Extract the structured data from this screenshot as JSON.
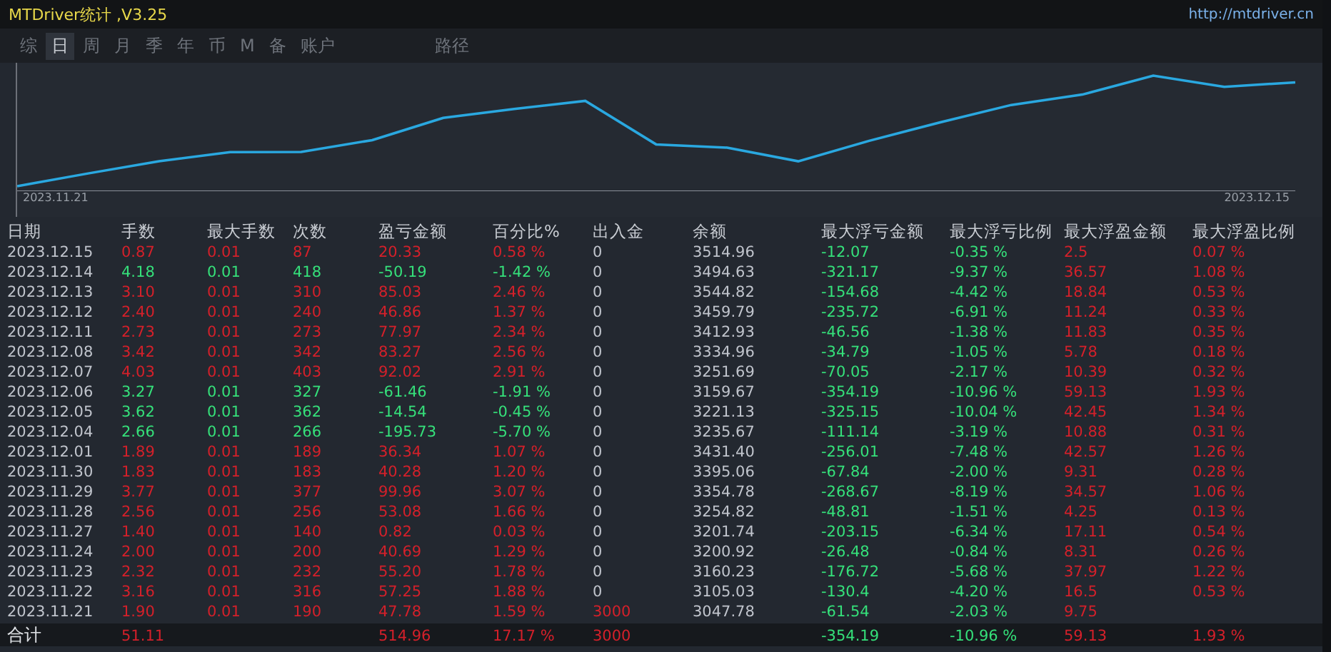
{
  "window": {
    "title": "MTDriver统计 ,V3.25",
    "link": "http://mtdriver.cn"
  },
  "tabs": [
    {
      "label": "综",
      "selected": false
    },
    {
      "label": "日",
      "selected": true
    },
    {
      "label": "周",
      "selected": false
    },
    {
      "label": "月",
      "selected": false
    },
    {
      "label": "季",
      "selected": false
    },
    {
      "label": "年",
      "selected": false
    },
    {
      "label": "币",
      "selected": false
    },
    {
      "label": "M",
      "selected": false
    },
    {
      "label": "备",
      "selected": false
    },
    {
      "label": "账户",
      "selected": false
    },
    {
      "label": "路径",
      "selected": false
    }
  ],
  "chart": {
    "start_label": "2023.11.21",
    "end_label": "2023.12.15"
  },
  "table": {
    "columns": [
      {
        "label": "日期",
        "kind": "plain"
      },
      {
        "label": "手数",
        "kind": "result"
      },
      {
        "label": "最大手数",
        "kind": "result"
      },
      {
        "label": "次数",
        "kind": "result"
      },
      {
        "label": "盈亏金额",
        "kind": "result"
      },
      {
        "label": "百分比%",
        "kind": "result"
      },
      {
        "label": "出入金",
        "kind": "deposit"
      },
      {
        "label": "余额",
        "kind": "plain"
      },
      {
        "label": "最大浮亏金额",
        "kind": "loss"
      },
      {
        "label": "最大浮亏比例",
        "kind": "loss"
      },
      {
        "label": "最大浮盈金额",
        "kind": "gain"
      },
      {
        "label": "最大浮盈比例",
        "kind": "gain"
      }
    ],
    "rows": [
      {
        "loss": false,
        "deposit": false,
        "cells": [
          "2023.12.15",
          "0.87",
          "0.01",
          "87",
          "20.33",
          "0.58 %",
          "0",
          "3514.96",
          "-12.07",
          "-0.35 %",
          "2.5",
          "0.07 %"
        ]
      },
      {
        "loss": true,
        "deposit": false,
        "cells": [
          "2023.12.14",
          "4.18",
          "0.01",
          "418",
          "-50.19",
          "-1.42 %",
          "0",
          "3494.63",
          "-321.17",
          "-9.37 %",
          "36.57",
          "1.08 %"
        ]
      },
      {
        "loss": false,
        "deposit": false,
        "cells": [
          "2023.12.13",
          "3.10",
          "0.01",
          "310",
          "85.03",
          "2.46 %",
          "0",
          "3544.82",
          "-154.68",
          "-4.42 %",
          "18.84",
          "0.53 %"
        ]
      },
      {
        "loss": false,
        "deposit": false,
        "cells": [
          "2023.12.12",
          "2.40",
          "0.01",
          "240",
          "46.86",
          "1.37 %",
          "0",
          "3459.79",
          "-235.72",
          "-6.91 %",
          "11.24",
          "0.33 %"
        ]
      },
      {
        "loss": false,
        "deposit": false,
        "cells": [
          "2023.12.11",
          "2.73",
          "0.01",
          "273",
          "77.97",
          "2.34 %",
          "0",
          "3412.93",
          "-46.56",
          "-1.38 %",
          "11.83",
          "0.35 %"
        ]
      },
      {
        "loss": false,
        "deposit": false,
        "cells": [
          "2023.12.08",
          "3.42",
          "0.01",
          "342",
          "83.27",
          "2.56 %",
          "0",
          "3334.96",
          "-34.79",
          "-1.05 %",
          "5.78",
          "0.18 %"
        ]
      },
      {
        "loss": false,
        "deposit": false,
        "cells": [
          "2023.12.07",
          "4.03",
          "0.01",
          "403",
          "92.02",
          "2.91 %",
          "0",
          "3251.69",
          "-70.05",
          "-2.17 %",
          "10.39",
          "0.32 %"
        ]
      },
      {
        "loss": true,
        "deposit": false,
        "cells": [
          "2023.12.06",
          "3.27",
          "0.01",
          "327",
          "-61.46",
          "-1.91 %",
          "0",
          "3159.67",
          "-354.19",
          "-10.96 %",
          "59.13",
          "1.93 %"
        ]
      },
      {
        "loss": true,
        "deposit": false,
        "cells": [
          "2023.12.05",
          "3.62",
          "0.01",
          "362",
          "-14.54",
          "-0.45 %",
          "0",
          "3221.13",
          "-325.15",
          "-10.04 %",
          "42.45",
          "1.34 %"
        ]
      },
      {
        "loss": true,
        "deposit": false,
        "cells": [
          "2023.12.04",
          "2.66",
          "0.01",
          "266",
          "-195.73",
          "-5.70 %",
          "0",
          "3235.67",
          "-111.14",
          "-3.19 %",
          "10.88",
          "0.31 %"
        ]
      },
      {
        "loss": false,
        "deposit": false,
        "cells": [
          "2023.12.01",
          "1.89",
          "0.01",
          "189",
          "36.34",
          "1.07 %",
          "0",
          "3431.40",
          "-256.01",
          "-7.48 %",
          "42.57",
          "1.26 %"
        ]
      },
      {
        "loss": false,
        "deposit": false,
        "cells": [
          "2023.11.30",
          "1.83",
          "0.01",
          "183",
          "40.28",
          "1.20 %",
          "0",
          "3395.06",
          "-67.84",
          "-2.00 %",
          "9.31",
          "0.28 %"
        ]
      },
      {
        "loss": false,
        "deposit": false,
        "cells": [
          "2023.11.29",
          "3.77",
          "0.01",
          "377",
          "99.96",
          "3.07 %",
          "0",
          "3354.78",
          "-268.67",
          "-8.19 %",
          "34.57",
          "1.06 %"
        ]
      },
      {
        "loss": false,
        "deposit": false,
        "cells": [
          "2023.11.28",
          "2.56",
          "0.01",
          "256",
          "53.08",
          "1.66 %",
          "0",
          "3254.82",
          "-48.81",
          "-1.51 %",
          "4.25",
          "0.13 %"
        ]
      },
      {
        "loss": false,
        "deposit": false,
        "cells": [
          "2023.11.27",
          "1.40",
          "0.01",
          "140",
          "0.82",
          "0.03 %",
          "0",
          "3201.74",
          "-203.15",
          "-6.34 %",
          "17.11",
          "0.54 %"
        ]
      },
      {
        "loss": false,
        "deposit": false,
        "cells": [
          "2023.11.24",
          "2.00",
          "0.01",
          "200",
          "40.69",
          "1.29 %",
          "0",
          "3200.92",
          "-26.48",
          "-0.84 %",
          "8.31",
          "0.26 %"
        ]
      },
      {
        "loss": false,
        "deposit": false,
        "cells": [
          "2023.11.23",
          "2.32",
          "0.01",
          "232",
          "55.20",
          "1.78 %",
          "0",
          "3160.23",
          "-176.72",
          "-5.68 %",
          "37.97",
          "1.22 %"
        ]
      },
      {
        "loss": false,
        "deposit": false,
        "cells": [
          "2023.11.22",
          "3.16",
          "0.01",
          "316",
          "57.25",
          "1.88 %",
          "0",
          "3105.03",
          "-130.4",
          "-4.20 %",
          "16.5",
          "0.53 %"
        ]
      },
      {
        "loss": false,
        "deposit": true,
        "cells": [
          "2023.11.21",
          "1.90",
          "0.01",
          "190",
          "47.78",
          "1.59 %",
          "3000",
          "3047.78",
          "-61.54",
          "-2.03 %",
          "9.75"
        ]
      }
    ],
    "total": {
      "loss": false,
      "deposit": true,
      "cells": [
        "合计",
        "51.11",
        null,
        null,
        "514.96",
        "17.17 %",
        "3000",
        null,
        "-354.19",
        "-10.96 %",
        "59.13",
        "1.93 %"
      ]
    }
  }
}
